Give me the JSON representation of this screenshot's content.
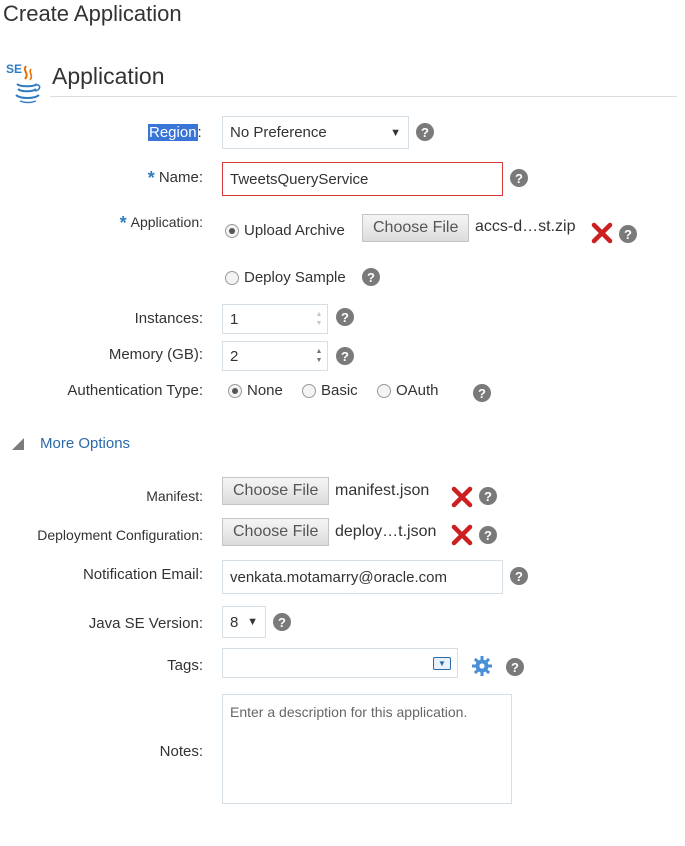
{
  "page": {
    "title": "Create Application"
  },
  "section": {
    "title": "Application",
    "logo_text": "SE"
  },
  "fields": {
    "region": {
      "label": "Region",
      "colon": ":",
      "value": "No Preference"
    },
    "name": {
      "required": "*",
      "label": "Name:",
      "value": "TweetsQueryService"
    },
    "application": {
      "required": "*",
      "label": "Application:",
      "upload_label": "Upload Archive",
      "choose_label": "Choose File",
      "file_name": "accs-d…st.zip",
      "sample_label": "Deploy Sample"
    },
    "instances": {
      "label": "Instances:",
      "value": "1"
    },
    "memory": {
      "label": "Memory (GB):",
      "value": "2"
    },
    "auth": {
      "label": "Authentication Type:",
      "options": [
        "None",
        "Basic",
        "OAuth"
      ],
      "selected": "None"
    },
    "more_options": "More Options",
    "manifest": {
      "label": "Manifest:",
      "choose_label": "Choose File",
      "file_name": "manifest.json"
    },
    "deploy_config": {
      "label": "Deployment Configuration:",
      "choose_label": "Choose File",
      "file_name": "deploy…t.json"
    },
    "email": {
      "label": "Notification Email:",
      "value": "venkata.motamarry@oracle.com"
    },
    "java": {
      "label": "Java SE Version:",
      "value": "8"
    },
    "tags": {
      "label": "Tags:",
      "value": ""
    },
    "notes": {
      "label": "Notes:",
      "placeholder": "Enter a description for this application."
    }
  },
  "icons": {
    "help": "help-icon",
    "remove": "remove-x-icon",
    "gear": "gear-icon",
    "logo": "java-se-logo"
  },
  "colors": {
    "accent": "#2a6aa8",
    "required": "#2f7cc1",
    "error_border": "#d33a3a",
    "remove": "#cc1f1f",
    "gear": "#4a90d9"
  },
  "help_glyph": "?"
}
